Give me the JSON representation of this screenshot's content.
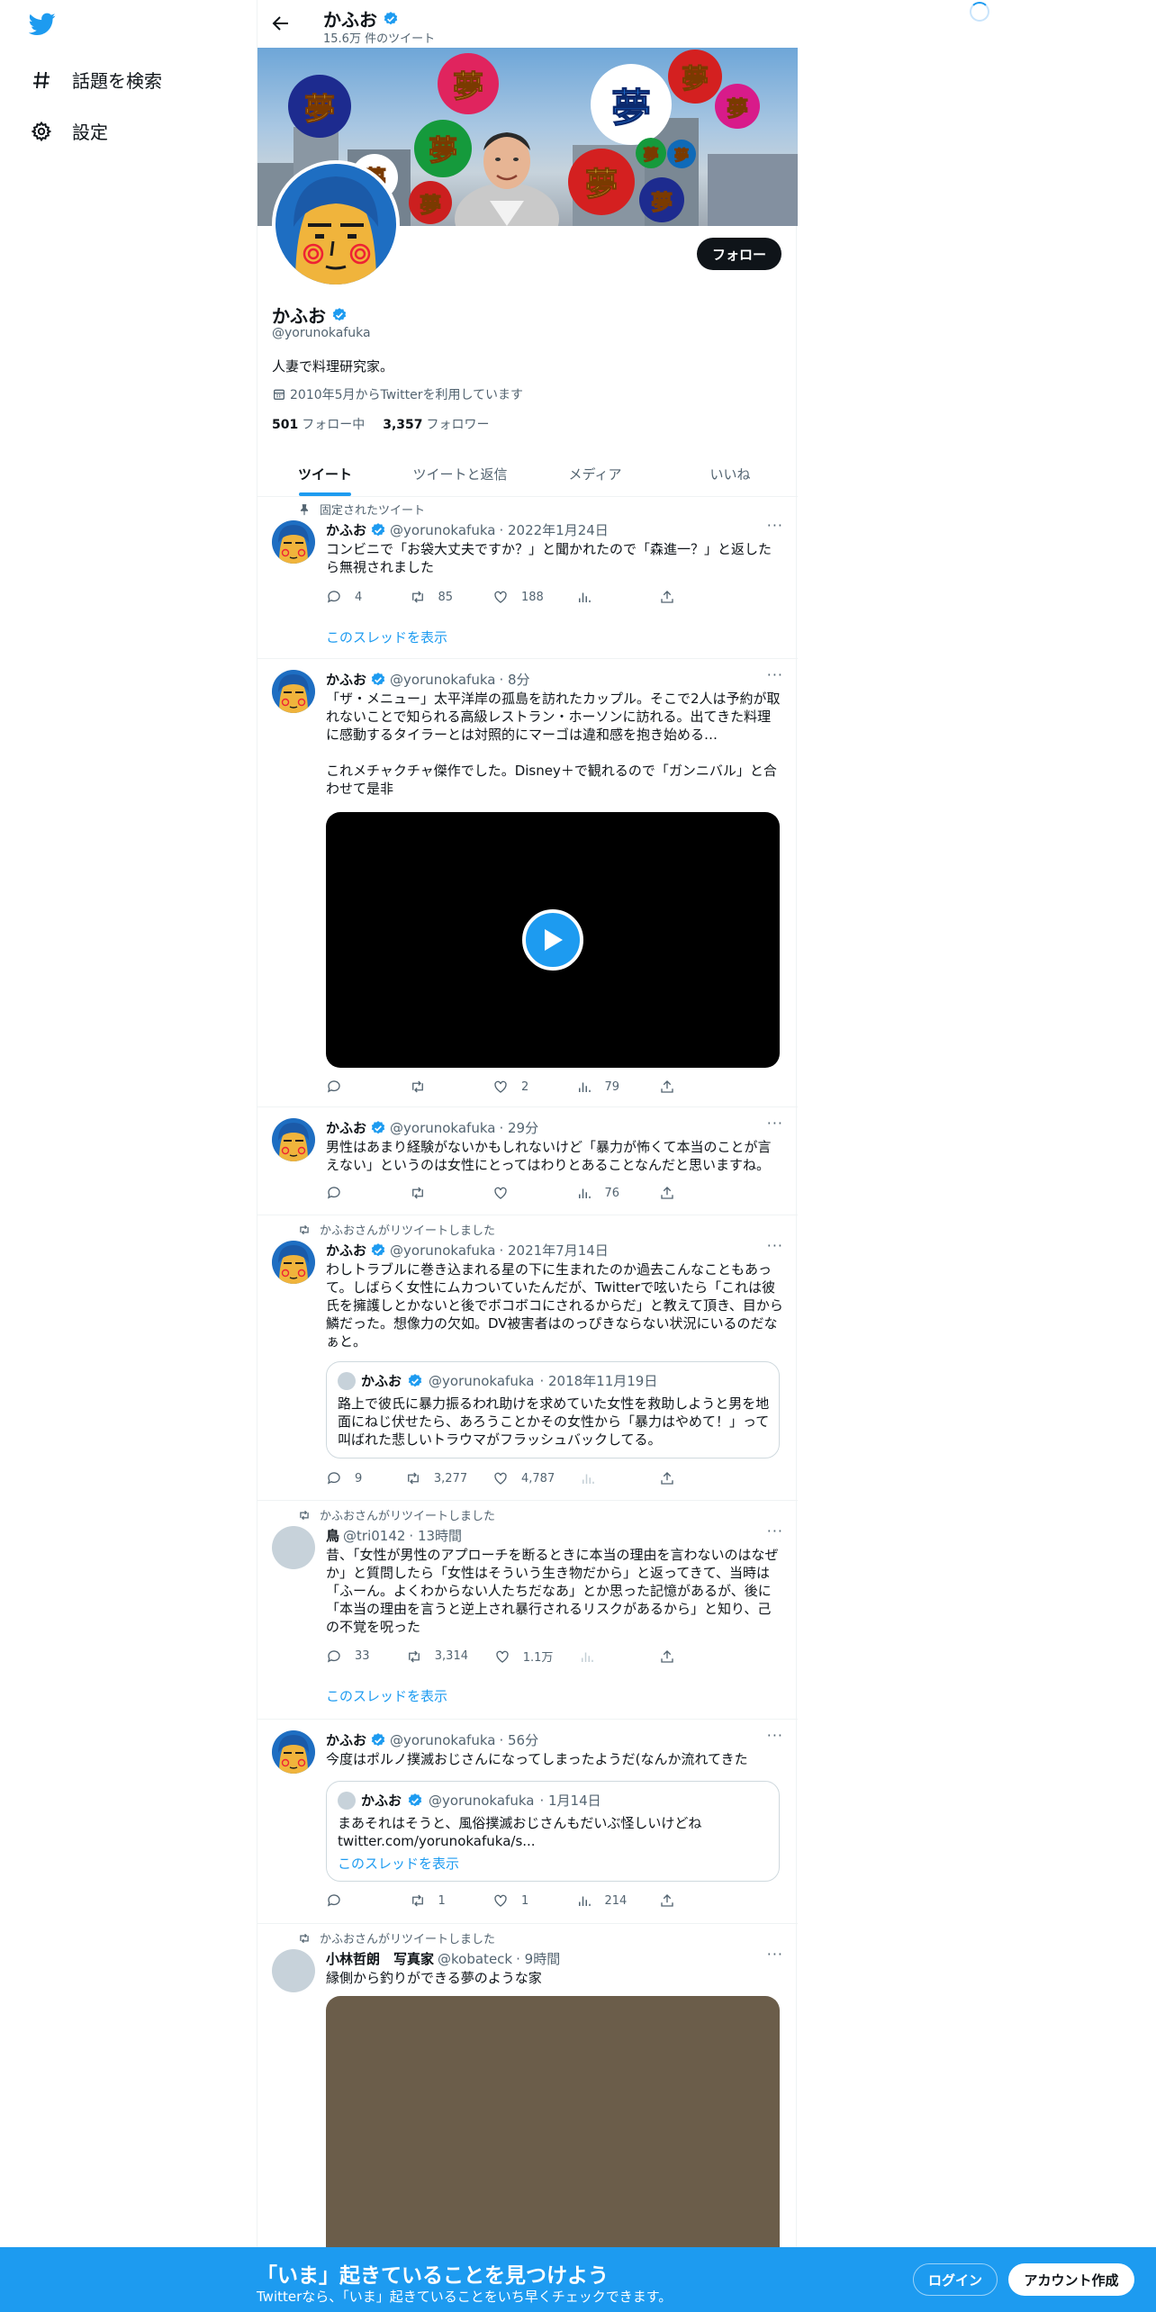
{
  "nav": {
    "logo_icon": "bird-icon",
    "explore_label": "話題を検索",
    "settings_label": "設定"
  },
  "header": {
    "name": "かふお",
    "tweet_count": "15.6万 件のツイート"
  },
  "profile": {
    "name": "かふお",
    "handle": "@yorunokafuka",
    "bio": "人妻で料理研究家。",
    "joined": "2010年5月からTwitterを利用しています",
    "following_count": "501",
    "following_label": "フォロー中",
    "followers_count": "3,357",
    "followers_label": "フォロワー",
    "follow_button": "フォロー",
    "banner_badges": [
      "夢",
      "夢",
      "夢",
      "夢",
      "夢",
      "夢",
      "夢",
      "夢",
      "夢",
      "夢",
      "夢",
      "夢"
    ]
  },
  "tabs": [
    "ツイート",
    "ツイートと返信",
    "メディア",
    "いいね"
  ],
  "tweets": [
    {
      "social": "固定されたツイート",
      "name": "かふお",
      "handle": "@yorunokafuka",
      "time": "· 2022年1月24日",
      "text": "コンビニで「お袋大丈夫ですか？」と聞かれたので「森進一？」と返したら無視されました",
      "replies": "4",
      "retweets": "85",
      "likes": "188",
      "views": "",
      "thread_link": "このスレッドを表示"
    },
    {
      "name": "かふお",
      "handle": "@yorunokafuka",
      "time": "· 8分",
      "text": "「ザ・メニュー」太平洋岸の孤島を訪れたカップル。そこで2人は予約が取れないことで知られる高級レストラン・ホーソンに訪れる。出てきた料理に感動するタイラーとは対照的にマーゴは違和感を抱き始める…\n\nこれメチャクチャ傑作でした。Disney＋で観れるので「ガンニバル」と合わせて是非",
      "replies": "",
      "retweets": "",
      "likes": "2",
      "views": "79"
    },
    {
      "name": "かふお",
      "handle": "@yorunokafuka",
      "time": "· 29分",
      "text": "男性はあまり経験がないかもしれないけど「暴力が怖くて本当のことが言えない」というのは女性にとってはわりとあることなんだと思いますね。",
      "replies": "",
      "retweets": "",
      "likes": "",
      "views": "76"
    },
    {
      "social": "かふおさんがリツイートしました",
      "name": "かふお",
      "handle": "@yorunokafuka",
      "time": "· 2021年7月14日",
      "text": "わしトラブルに巻き込まれる星の下に生まれたのか過去こんなこともあって。しばらく女性にムカついていたんだが、Twitterで呟いたら「これは彼氏を擁護しとかないと後でボコボコにされるからだ」と教えて頂き、目から鱗だった。想像力の欠如。DV被害者はのっぴきならない状況にいるのだなぁと。",
      "quote": {
        "name": "かふお",
        "handle": "@yorunokafuka",
        "time": "· 2018年11月19日",
        "text": "路上で彼氏に暴力振るわれ助けを求めていた女性を救助しようと男を地面にねじ伏せたら、あろうことかその女性から「暴力はやめて！」って叫ばれた悲しいトラウマがフラッシュバックしてる。"
      },
      "replies": "9",
      "retweets": "3,277",
      "likes": "4,787",
      "views": ""
    },
    {
      "social": "かふおさんがリツイートしました",
      "name": "鳥",
      "handle": "@tri0142",
      "time": "· 13時間",
      "text": "昔、「女性が男性のアプローチを断るときに本当の理由を言わないのはなぜか」と質問したら「女性はそういう生き物だから」と返ってきて、当時は「ふーん。よくわからない人たちだなあ」とか思った記憶があるが、後に「本当の理由を言うと逆上され暴行されるリスクがあるから」と知り、己の不覚を呪った",
      "replies": "33",
      "retweets": "3,314",
      "likes": "1.1万",
      "views": "",
      "thread_link": "このスレッドを表示"
    },
    {
      "name": "かふお",
      "handle": "@yorunokafuka",
      "time": "· 56分",
      "text": "今度はポルノ撲滅おじさんになってしまったようだ(なんか流れてきた",
      "quote": {
        "name": "かふお",
        "handle": "@yorunokafuka",
        "time": "· 1月14日",
        "text": "まあそれはそうと、風俗撲滅おじさんもだいぶ怪しいけどね\ntwitter.com/yorunokafuka/s...",
        "thread_link": "このスレッドを表示"
      },
      "replies": "",
      "retweets": "1",
      "likes": "1",
      "views": "214"
    },
    {
      "social": "かふおさんがリツイートしました",
      "name": "小林哲朗　写真家",
      "handle": "@kobateck",
      "time": "· 9時間",
      "text": "縁側から釣りができる夢のような家"
    }
  ],
  "bottom_bar": {
    "title": "「いま」起きていることを見つけよう",
    "subtitle": "Twitterなら、「いま」起きていることをいち早くチェックできます。",
    "login": "ログイン",
    "signup": "アカウント作成"
  },
  "colors": {
    "accent": "#1d9bf0",
    "text": "#0f1419",
    "secondary": "#536471"
  }
}
